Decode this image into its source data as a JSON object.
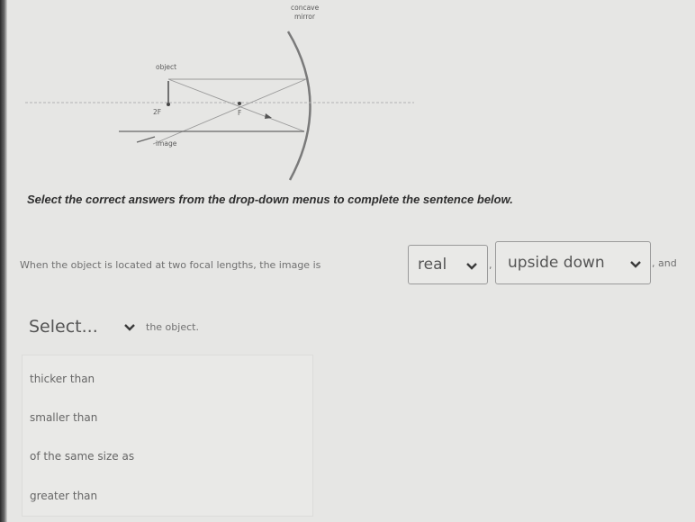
{
  "diagram": {
    "title_line1": "concave",
    "title_line2": "mirror",
    "object_label": "object",
    "twoF_label": "2F",
    "f_label": "F",
    "image_label": "image"
  },
  "instructions": "Select the correct answers from the drop-down menus to complete the sentence below.",
  "sentence": {
    "part1": "When the object is located at two focal lengths, the image is",
    "dropdown1_value": "real",
    "comma": ",",
    "dropdown2_value": "upside down",
    "part2": ", and",
    "dropdown3_value": "Select...",
    "part3": "the object."
  },
  "options": [
    "thicker than",
    "smaller than",
    "of the same size as",
    "greater than"
  ],
  "icons": {
    "dropdown": "chevron-down-icon"
  }
}
